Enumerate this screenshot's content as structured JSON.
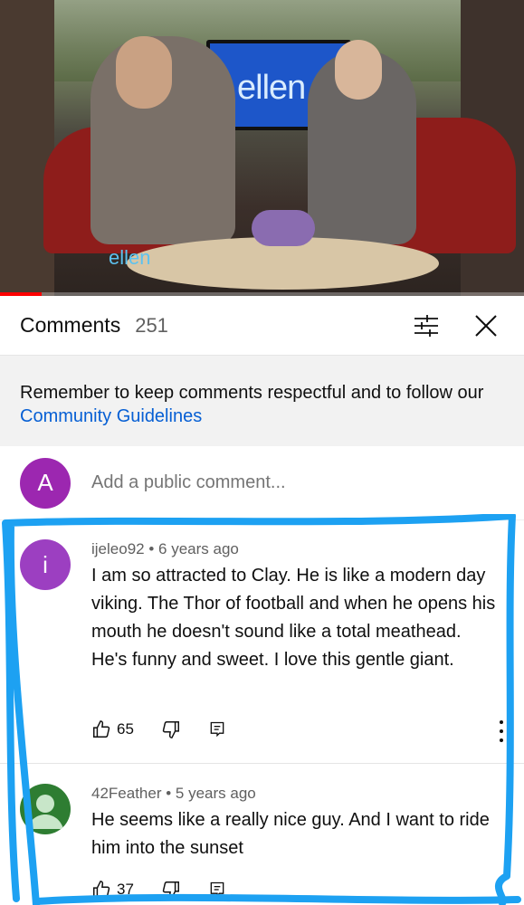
{
  "video": {
    "tv_text": "ellen",
    "logo_text": "ellen",
    "progress_fraction": 0.08
  },
  "header": {
    "title": "Comments",
    "count": "251"
  },
  "banner": {
    "text": "Remember to keep comments respectful and to follow our ",
    "link": "Community Guidelines"
  },
  "add_comment": {
    "avatar_letter": "A",
    "avatar_color": "#9c27b0",
    "placeholder": "Add a public comment..."
  },
  "comments": [
    {
      "avatar_letter": "i",
      "avatar_color": "#9c3fc1",
      "author": "ijeleo92",
      "time": "6 years ago",
      "text": "I am so attracted to Clay. He is like a modern day viking. The Thor of football and when he opens his mouth he doesn't sound like a total meathead. He's funny and sweet. I love this gentle giant.",
      "likes": "65"
    },
    {
      "avatar_letter": "",
      "avatar_color": "#2e7d32",
      "author": "42Feather",
      "time": "5 years ago",
      "text": "He seems like a really nice guy. And I want to ride him into the sunset",
      "likes": "37"
    }
  ],
  "colors": {
    "highlight": "#1da1f2",
    "link": "#065fd4"
  }
}
